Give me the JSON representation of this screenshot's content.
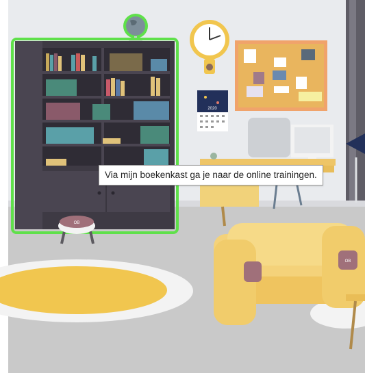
{
  "tooltip": {
    "text": "Via mijn boekenkast ga je naar de online trainingen."
  },
  "calendar": {
    "label": "2020"
  },
  "pillow": {
    "badge": "OB"
  },
  "stool": {
    "badge": "OB"
  },
  "colors": {
    "wall": "#e9ebee",
    "floor": "#c9c9c9",
    "bookcase": "#3e3a44",
    "highlight": "#5fe04a",
    "rug": "#f1c64f",
    "sofa": "#f4d27a",
    "corkboard": "#e9b55e",
    "desk": "#eec567"
  },
  "icons": [
    "globe-icon",
    "wall-clock-icon",
    "lamp-icon"
  ]
}
